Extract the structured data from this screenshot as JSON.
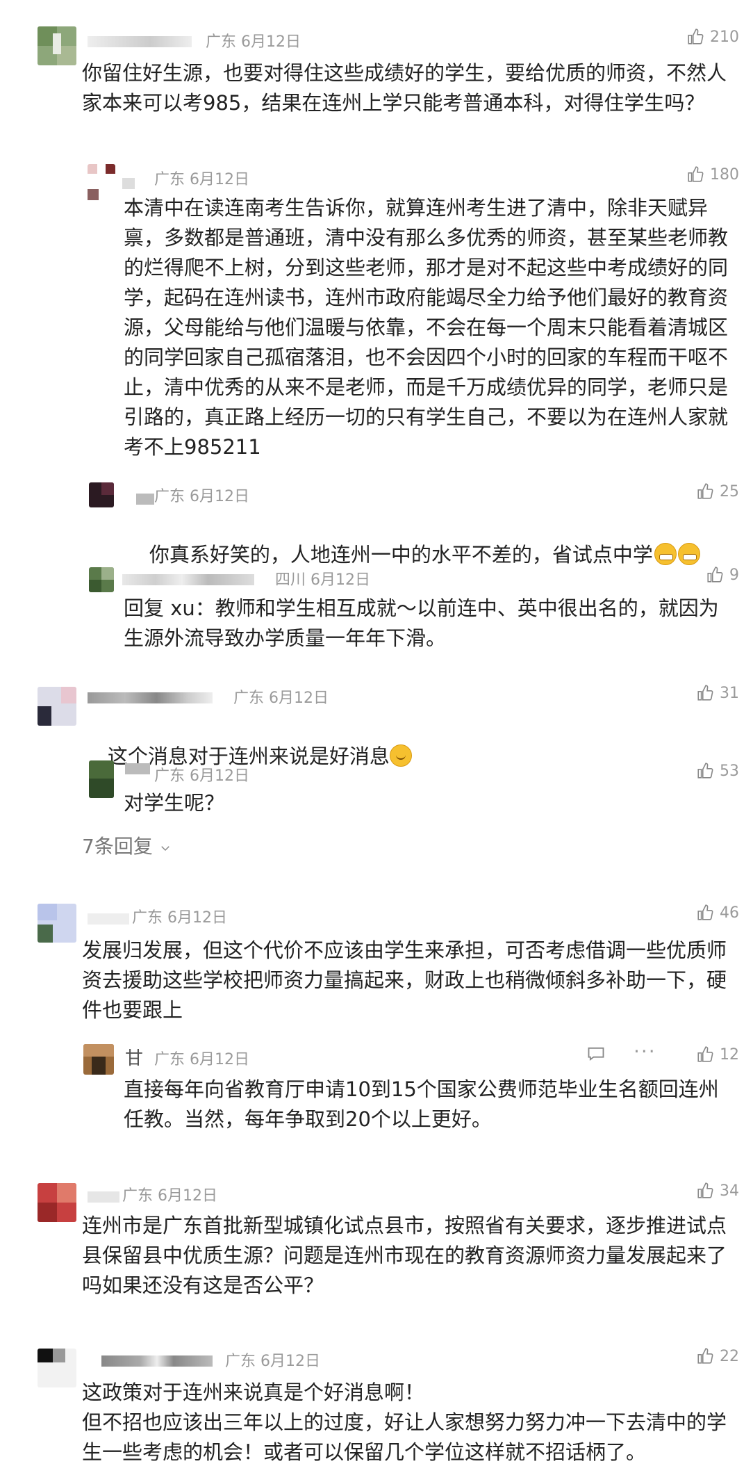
{
  "like_icon": "thumbs-up-icon",
  "comments": [
    {
      "location": "广东",
      "date": "6月12日",
      "likes": "210",
      "text": "你留住好生源，也要对得住这些成绩好的学生，要给优质的师资，不然人家本来可以考985，结果在连州上学只能考普通本科，对得住学生吗？"
    },
    {
      "location": "广东",
      "date": "6月12日",
      "likes": "180",
      "text": "本清中在读连南考生告诉你，就算连州考生进了清中，除非天赋异禀，多数都是普通班，清中没有那么多优秀的师资，甚至某些老师教的烂得爬不上树，分到这些老师，那才是对不起这些中考成绩好的同学，起码在连州读书，连州市政府能竭尽全力给予他们最好的教育资源，父母能给与他们温暖与依靠，不会在每一个周末只能看着清城区的同学回家自己孤宿落泪，也不会因四个小时的回家的车程而干呕不止，清中优秀的从来不是老师，而是千万成绩优异的同学，老师只是引路的，真正路上经历一切的只有学生自己，不要以为在连州人家就考不上985211"
    },
    {
      "location": "广东",
      "date": "6月12日",
      "likes": "25",
      "text": "你真系好笑的，人地连州一中的水平不差的，省试点中学"
    },
    {
      "location": "四川",
      "date": "6月12日",
      "likes": "9",
      "text": "回复 xu：教师和学生相互成就～以前连中、英中很出名的，就因为生源外流导致办学质量一年年下滑。"
    },
    {
      "location": "广东",
      "date": "6月12日",
      "likes": "31",
      "text": "这个消息对于连州来说是好消息"
    },
    {
      "location": "广东",
      "date": "6月12日",
      "likes": "53",
      "text": "对学生呢？"
    },
    {
      "location": "广东",
      "date": "6月12日",
      "likes": "46",
      "text": "发展归发展，但这个代价不应该由学生来承担，可否考虑借调一些优质师资去援助这些学校把师资力量搞起来，财政上也稍微倾斜多补助一下，硬件也要跟上"
    },
    {
      "name": "甘",
      "location": "广东",
      "date": "6月12日",
      "likes": "12",
      "text": "直接每年向省教育厅申请10到15个国家公费师范毕业生名额回连州任教。当然，每年争取到20个以上更好。"
    },
    {
      "location": "广东",
      "date": "6月12日",
      "likes": "34",
      "text": "连州市是广东首批新型城镇化试点县市，按照省有关要求，逐步推进试点县保留县中优质生源？问题是连州市现在的教育资源师资力量发展起来了吗如果还没有这是否公平？"
    },
    {
      "location": "广东",
      "date": "6月12日",
      "likes": "22",
      "text": "这政策对于连州来说真是个好消息啊！\n但不招也应该出三年以上的过度，好让人家想努力努力冲一下去清中的学生一些考虑的机会！或者可以保留几个学位这样就不招话柄了。"
    }
  ],
  "more_replies": "7条回复",
  "chevron_icon": "chevron-down-icon",
  "reply_icon": "comment-icon",
  "more_icon": "ellipsis-icon"
}
